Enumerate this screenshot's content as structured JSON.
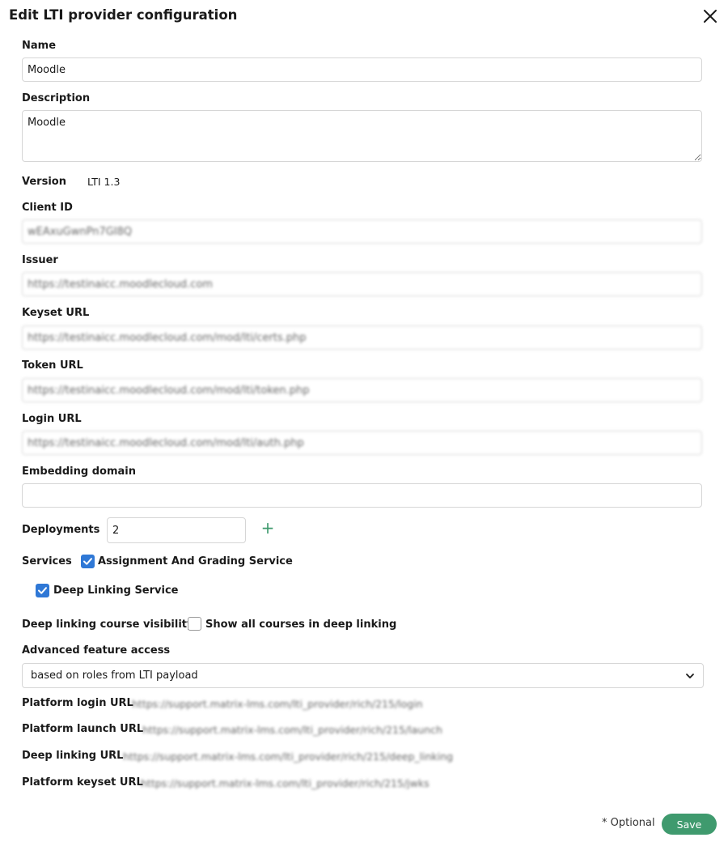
{
  "dialog": {
    "title": "Edit LTI provider configuration"
  },
  "form": {
    "name": {
      "label": "Name",
      "value": "Moodle"
    },
    "description": {
      "label": "Description",
      "value": "Moodle"
    },
    "version": {
      "label": "Version",
      "value": "LTI 1.3"
    },
    "client_id": {
      "label": "Client ID",
      "value": "wEAxuGwnPn7GI8Q"
    },
    "issuer": {
      "label": "Issuer",
      "value": "https://testinaicc.moodlecloud.com"
    },
    "keyset_url": {
      "label": "Keyset URL",
      "value": "https://testinaicc.moodlecloud.com/mod/lti/certs.php"
    },
    "token_url": {
      "label": "Token URL",
      "value": "https://testinaicc.moodlecloud.com/mod/lti/token.php"
    },
    "login_url": {
      "label": "Login URL",
      "value": "https://testinaicc.moodlecloud.com/mod/lti/auth.php"
    },
    "embedding_domain": {
      "label": "Embedding domain",
      "value": ""
    },
    "deployments": {
      "label": "Deployments",
      "value": "2",
      "add_icon": "plus-icon"
    },
    "services": {
      "label": "Services",
      "items": [
        {
          "label": "Assignment And Grading Service",
          "checked": true
        },
        {
          "label": "Deep Linking Service",
          "checked": true
        }
      ]
    },
    "deep_linking_visibility": {
      "label": "Deep linking course visibility",
      "option_label": "Show all courses in deep linking",
      "checked": false
    },
    "advanced_feature_access": {
      "label": "Advanced feature access",
      "selected": "based on roles from LTI payload"
    },
    "platform_login_url": {
      "label": "Platform login URL",
      "value": "https://support.matrix-lms.com/lti_provider/rich/215/login"
    },
    "platform_launch_url": {
      "label": "Platform launch URL",
      "value": "https://support.matrix-lms.com/lti_provider/rich/215/launch"
    },
    "deep_linking_url": {
      "label": "Deep linking URL",
      "value": "https://support.matrix-lms.com/lti_provider/rich/215/deep_linking"
    },
    "platform_keyset_url": {
      "label": "Platform keyset URL",
      "value": "https://support.matrix-lms.com/lti_provider/rich/215/jwks"
    }
  },
  "footer": {
    "optional_note": "* Optional",
    "save_label": "Save"
  },
  "colors": {
    "accent": "#3f9a6e",
    "checkbox": "#2f78d6"
  }
}
